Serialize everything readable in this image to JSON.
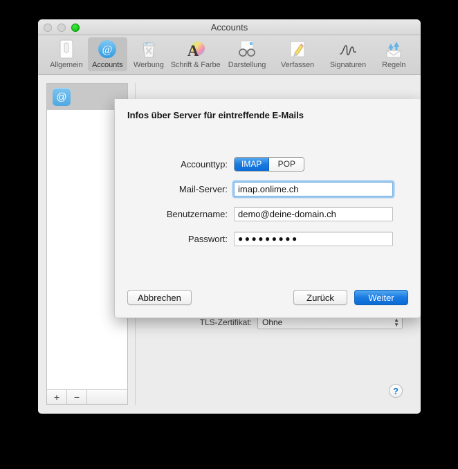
{
  "window": {
    "title": "Accounts",
    "traffic_lights": [
      "close-button",
      "minimize-button",
      "zoom-button"
    ]
  },
  "toolbar": {
    "items": [
      {
        "label": "Allgemein",
        "icon": "general-icon",
        "selected": false
      },
      {
        "label": "Accounts",
        "icon": "at-sign-icon",
        "selected": true
      },
      {
        "label": "Werbung",
        "icon": "junk-bin-icon",
        "selected": false
      },
      {
        "label": "Schrift & Farbe",
        "icon": "font-color-icon",
        "selected": false
      },
      {
        "label": "Darstellung",
        "icon": "glasses-icon",
        "selected": false
      },
      {
        "label": "Verfassen",
        "icon": "pencil-note-icon",
        "selected": false
      },
      {
        "label": "Signaturen",
        "icon": "signature-icon",
        "selected": false
      },
      {
        "label": "Regeln",
        "icon": "rules-mail-icon",
        "selected": false
      }
    ]
  },
  "sidebar": {
    "account_icon": "@",
    "add_label": "+",
    "remove_label": "−"
  },
  "background_pane": {
    "tls_label": "TLS-Zertifikat:",
    "tls_value": "Ohne",
    "help_label": "?"
  },
  "sheet": {
    "title": "Infos über Server für eintreffende E-Mails",
    "fields": [
      {
        "label": "Accounttyp:",
        "type": "segmented"
      },
      {
        "label": "Mail-Server:",
        "type": "text",
        "value": "imap.onlime.ch",
        "focused": true
      },
      {
        "label": "Benutzername:",
        "type": "text",
        "value": "demo@deine-domain.ch",
        "focused": false
      },
      {
        "label": "Passwort:",
        "type": "password",
        "value": "●●●●●●●●●",
        "focused": false
      }
    ],
    "account_type": {
      "options": [
        "IMAP",
        "POP"
      ],
      "selected": "IMAP"
    },
    "buttons": {
      "cancel": "Abbrechen",
      "back": "Zurück",
      "next": "Weiter"
    }
  },
  "colors": {
    "accent_blue": "#1b7ce2",
    "window_bg": "#ececec",
    "sheet_bg": "#f4f4f4",
    "focus_ring": "#74b2e8"
  }
}
